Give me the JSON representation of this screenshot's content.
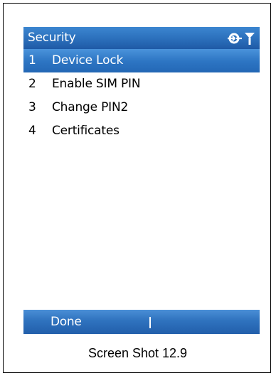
{
  "titlebar": {
    "title": "Security",
    "status_icons": [
      "connectivity-icon",
      "signal-strength-icon"
    ]
  },
  "menu": {
    "items": [
      {
        "number": "1",
        "label": "Device Lock",
        "selected": true
      },
      {
        "number": "2",
        "label": "Enable SIM PIN",
        "selected": false
      },
      {
        "number": "3",
        "label": "Change PIN2",
        "selected": false
      },
      {
        "number": "4",
        "label": "Certificates",
        "selected": false
      }
    ]
  },
  "softkeys": {
    "left_label": "Done"
  },
  "caption": "Screen Shot 12.9",
  "colors": {
    "accent": "#2b6fbb",
    "selected_row": "#2e76c4",
    "text_light": "#ffffff",
    "text_dark": "#000000"
  }
}
